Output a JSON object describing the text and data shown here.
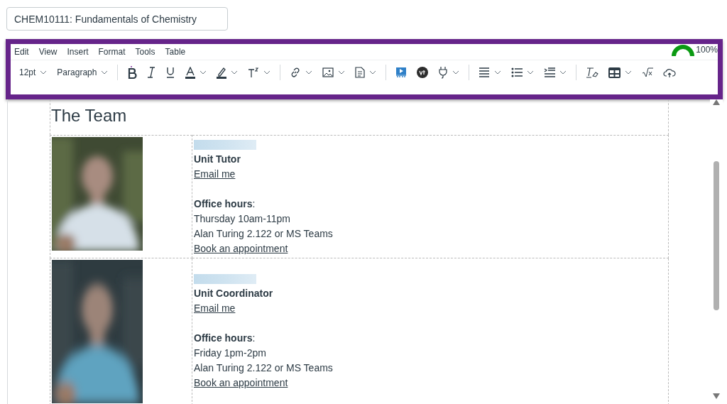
{
  "title_field": {
    "value": "CHEM10111: Fundamentals of Chemistry"
  },
  "menu": [
    "Edit",
    "View",
    "Insert",
    "Format",
    "Tools",
    "Table"
  ],
  "accessibility_score": {
    "reading": "100%"
  },
  "toolbar_groups": [
    [
      {
        "kind": "select",
        "label": "12pt"
      },
      {
        "kind": "select",
        "label": "Paragraph"
      }
    ],
    [
      {
        "kind": "icon",
        "dropdown": false
      },
      {
        "kind": "icon",
        "dropdown": false
      },
      {
        "kind": "icon",
        "dropdown": false
      },
      {
        "kind": "icon",
        "dropdown": true
      },
      {
        "kind": "icon",
        "dropdown": true
      },
      {
        "kind": "icon",
        "dropdown": true
      }
    ],
    [
      {
        "kind": "icon",
        "dropdown": true
      },
      {
        "kind": "icon",
        "dropdown": true
      },
      {
        "kind": "icon",
        "dropdown": true
      }
    ],
    [
      {
        "kind": "icon",
        "dropdown": false
      },
      {
        "kind": "icon",
        "dropdown": false
      },
      {
        "kind": "icon",
        "dropdown": true
      }
    ],
    [
      {
        "kind": "icon",
        "dropdown": true
      },
      {
        "kind": "icon",
        "dropdown": true
      },
      {
        "kind": "icon",
        "dropdown": true
      }
    ],
    [
      {
        "kind": "icon",
        "dropdown": false
      },
      {
        "kind": "icon",
        "dropdown": true
      },
      {
        "kind": "icon",
        "dropdown": false
      },
      {
        "kind": "icon",
        "dropdown": false
      }
    ]
  ],
  "content": {
    "heading": "The Team",
    "members": [
      {
        "role": "Unit Tutor",
        "email_link": "Email me",
        "office_hours_label": "**Office hours**:",
        "time": "Thursday 10am-11pm",
        "location": "Alan Turing 2.122 or MS Teams",
        "booking_link": "Book an appointment"
      },
      {
        "role": "Unit Coordinator",
        "email_link": "Email me",
        "office_hours_label": "**Office hours**:",
        "time": "Friday 1pm-2pm",
        "location": "Alan Turing 2.122 or MS Teams",
        "booking_link": "Book an appointment"
      }
    ]
  }
}
